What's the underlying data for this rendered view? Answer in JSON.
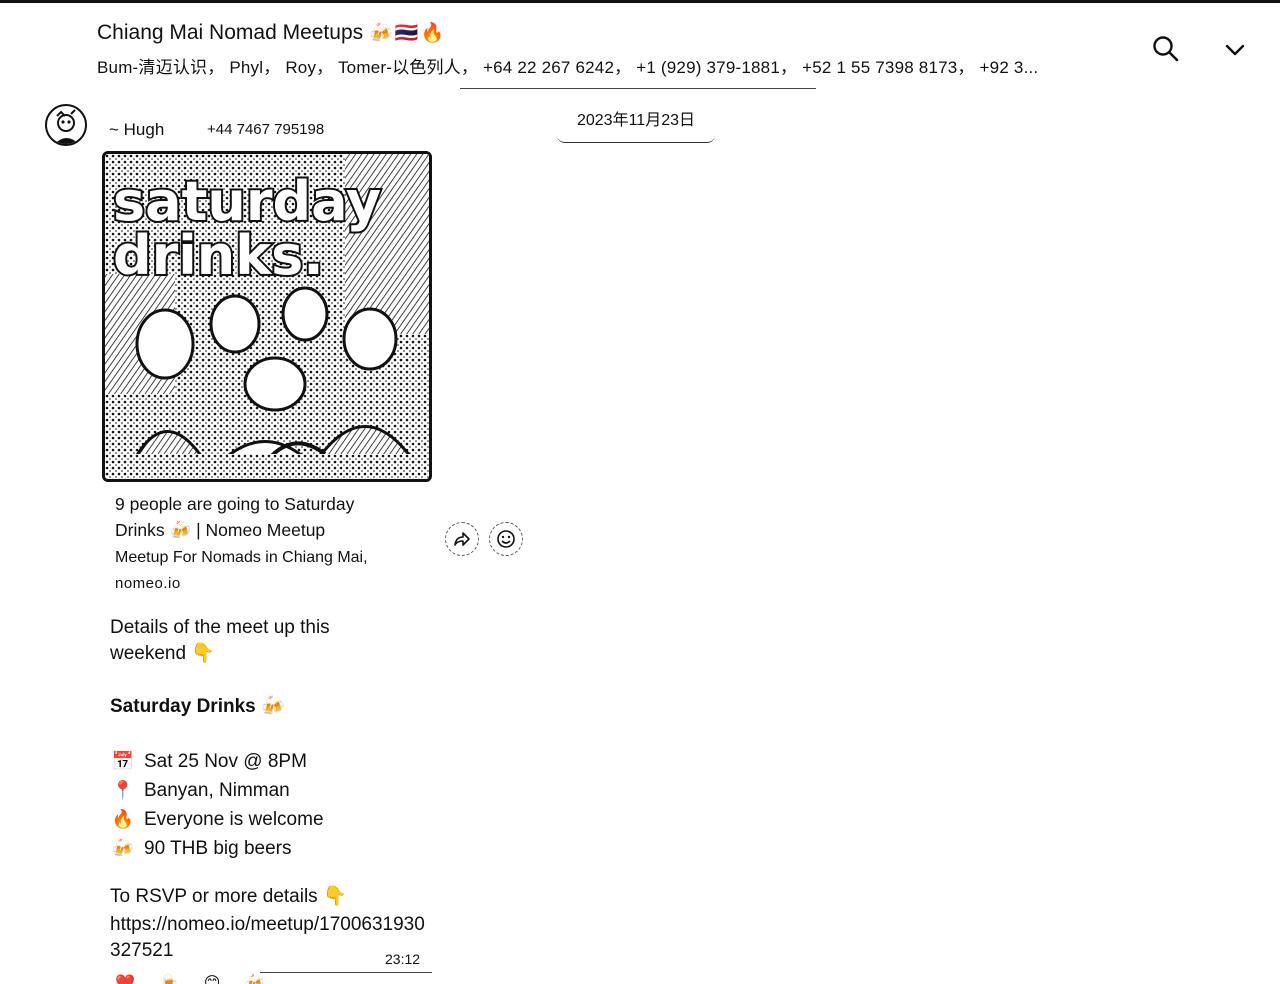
{
  "header": {
    "title": "Chiang Mai Nomad Meetups",
    "title_emoji": "🍻🇹🇭🔥",
    "members": "Bum-清迈认识， Phyl， Roy， Tomer-以色列人， +64 22 267 6242， +1 (929) 379-1881， +52 1 55 7398 8173， +92 3..."
  },
  "date_separator": "2023年11月23日",
  "message": {
    "sender_name": "~ Hugh",
    "sender_phone": "+44 7467 795198",
    "image_text": "saturday drinks.",
    "preview_title": "9 people are going to Saturday Drinks 🍻 | Nomeo Meetup",
    "preview_description": "Meetup For Nomads in Chiang Mai,",
    "preview_domain": "nomeo.io",
    "intro": "Details of the meet up this weekend",
    "intro_emoji": "👇",
    "event_title": "Saturday Drinks",
    "event_emoji": "🍻",
    "lines": [
      {
        "icon": "📅",
        "text": "Sat 25 Nov @ 8PM"
      },
      {
        "icon": "📍",
        "text": "Banyan, Nimman"
      },
      {
        "icon": "🔥",
        "text": "Everyone is welcome"
      },
      {
        "icon": "🍻",
        "text": "90 THB big beers"
      }
    ],
    "rsvp_text": "To RSVP or more details",
    "rsvp_emoji": "👇",
    "link": "https://nomeo.io/meetup/1700631930327521",
    "time": "23:12",
    "reactions": "❤️ 🍺 😊 🍻"
  },
  "actions": {
    "forward_icon": "forward-icon",
    "emoji_icon": "smiley-icon"
  }
}
